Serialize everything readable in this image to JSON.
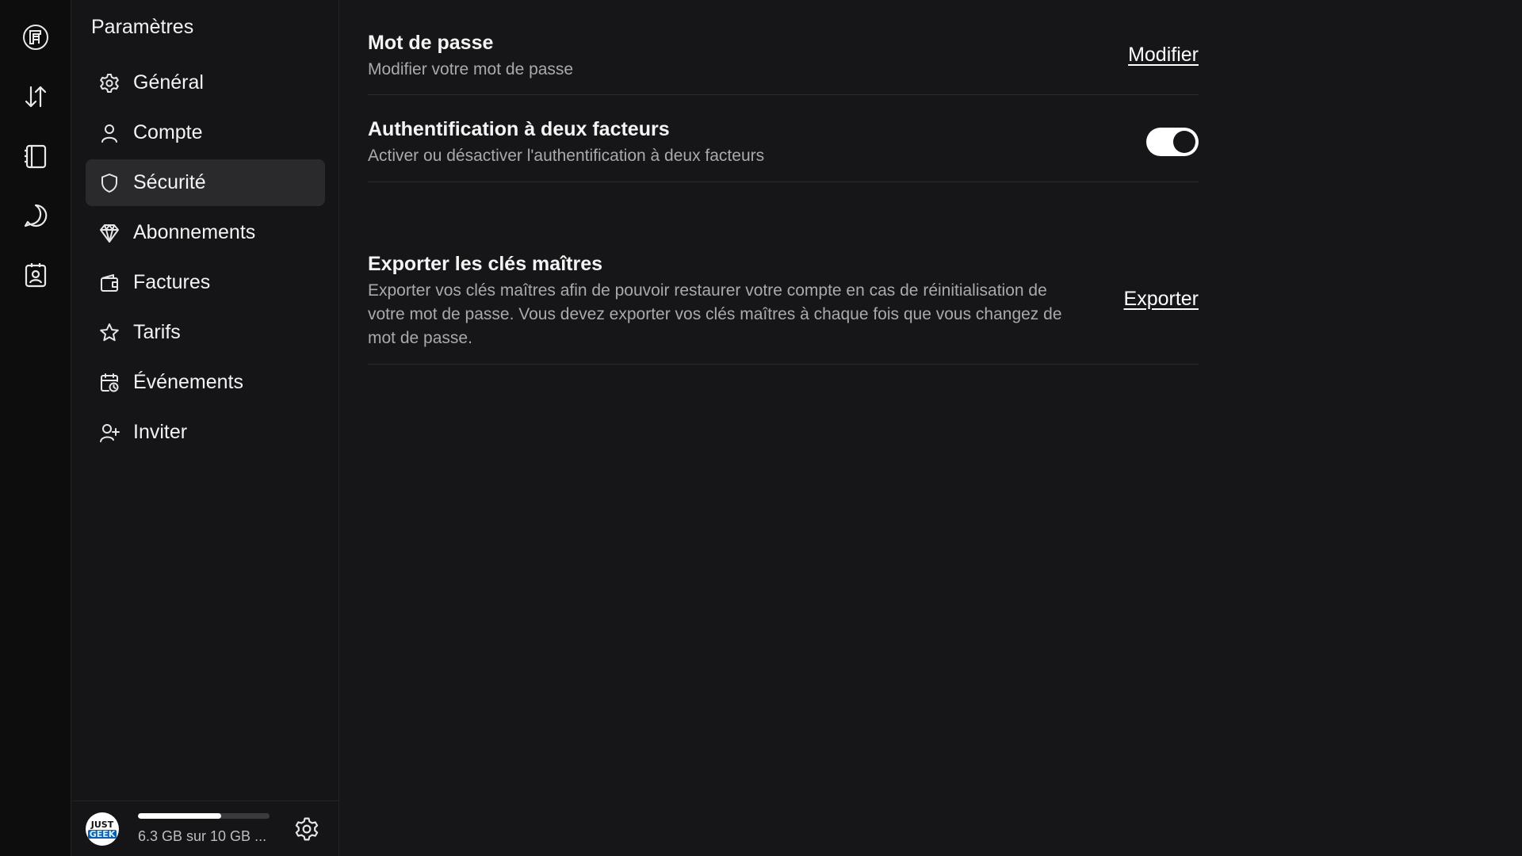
{
  "rail": {
    "items": [
      {
        "name": "drive-logo-icon"
      },
      {
        "name": "transfers-icon"
      },
      {
        "name": "notebook-icon"
      },
      {
        "name": "chat-icon"
      },
      {
        "name": "contacts-icon"
      }
    ]
  },
  "sidebar": {
    "title": "Paramètres",
    "items": [
      {
        "label": "Général",
        "icon": "gear-icon",
        "active": false
      },
      {
        "label": "Compte",
        "icon": "user-icon",
        "active": false
      },
      {
        "label": "Sécurité",
        "icon": "shield-icon",
        "active": true
      },
      {
        "label": "Abonnements",
        "icon": "diamond-icon",
        "active": false
      },
      {
        "label": "Factures",
        "icon": "wallet-icon",
        "active": false
      },
      {
        "label": "Tarifs",
        "icon": "star-icon",
        "active": false
      },
      {
        "label": "Événements",
        "icon": "calendar-clock-icon",
        "active": false
      },
      {
        "label": "Inviter",
        "icon": "user-plus-icon",
        "active": false
      }
    ],
    "footer": {
      "storage_text": "6.3 GB sur 10 GB ...",
      "storage_fraction": 0.63
    }
  },
  "security": {
    "password": {
      "title": "Mot de passe",
      "description": "Modifier votre mot de passe",
      "action_label": "Modifier"
    },
    "two_factor": {
      "title": "Authentification à deux facteurs",
      "description": "Activer ou désactiver l'authentification à deux facteurs",
      "enabled": true
    },
    "export_keys": {
      "title": "Exporter les clés maîtres",
      "description": "Exporter vos clés maîtres afin de pouvoir restaurer votre compte en cas de réinitialisation de votre mot de passe. Vous devez exporter vos clés maîtres à chaque fois que vous changez de mot de passe.",
      "action_label": "Exporter"
    }
  }
}
